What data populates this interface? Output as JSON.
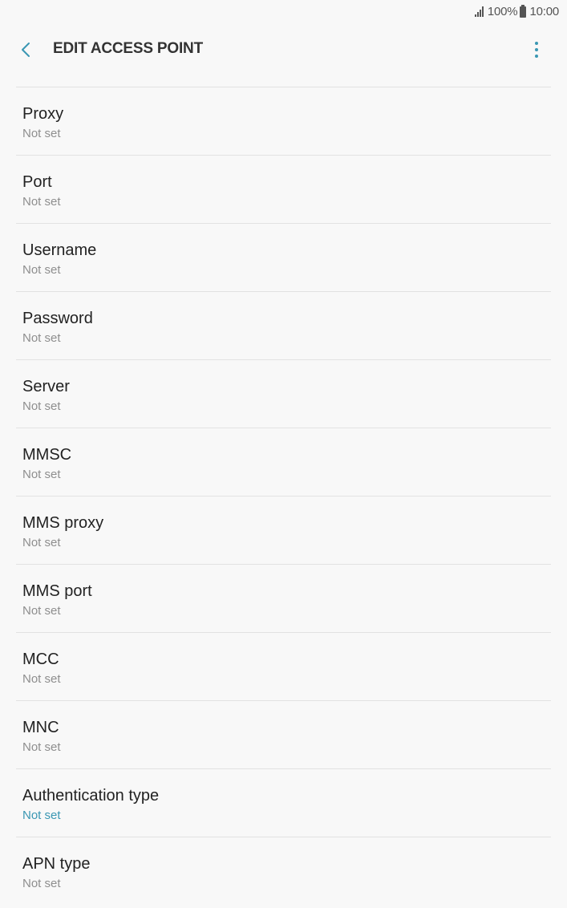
{
  "status_bar": {
    "battery_percent": "100%",
    "time": "10:00",
    "icons": [
      "signal-icon",
      "battery-icon"
    ]
  },
  "app_bar": {
    "title": "EDIT ACCESS POINT",
    "back_icon": "chevron-left-icon",
    "menu_icon": "more-vertical-icon"
  },
  "colors": {
    "accent": "#3a97b3",
    "background": "#f8f8f8",
    "divider": "#e2e2e2"
  },
  "settings": [
    {
      "label": "Proxy",
      "value": "Not set"
    },
    {
      "label": "Port",
      "value": "Not set"
    },
    {
      "label": "Username",
      "value": "Not set"
    },
    {
      "label": "Password",
      "value": "Not set"
    },
    {
      "label": "Server",
      "value": "Not set"
    },
    {
      "label": "MMSC",
      "value": "Not set"
    },
    {
      "label": "MMS proxy",
      "value": "Not set"
    },
    {
      "label": "MMS port",
      "value": "Not set"
    },
    {
      "label": "MCC",
      "value": "Not set"
    },
    {
      "label": "MNC",
      "value": "Not set"
    },
    {
      "label": "Authentication type",
      "value": "Not set",
      "accent": true
    },
    {
      "label": "APN type",
      "value": "Not set"
    }
  ]
}
